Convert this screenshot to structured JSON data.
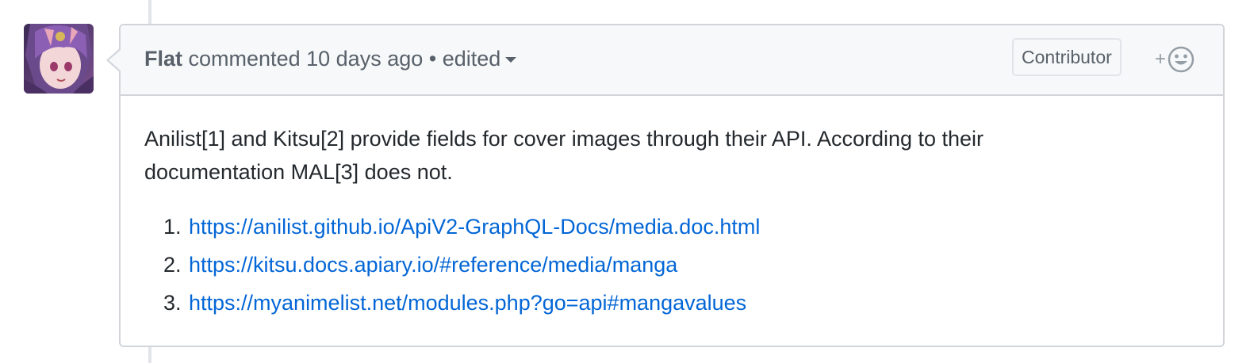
{
  "comment": {
    "author": "Flat",
    "action": "commented",
    "time": "10 days ago",
    "separator": "•",
    "edited_label": "edited",
    "badge": "Contributor",
    "reaction_plus": "+",
    "avatar_icon": "user-avatar",
    "reaction_icon": "smiley-icon",
    "body": {
      "paragraph": "Anilist[1] and Kitsu[2] provide fields for cover images through their API. According to their documentation MAL[3] does not.",
      "references": [
        {
          "number": "1.",
          "url": "https://anilist.github.io/ApiV2-GraphQL-Docs/media.doc.html"
        },
        {
          "number": "2.",
          "url": "https://kitsu.docs.apiary.io/#reference/media/manga"
        },
        {
          "number": "3.",
          "url": "https://myanimelist.net/modules.php?go=api#mangavalues"
        }
      ]
    }
  },
  "colors": {
    "link": "#0366d6",
    "muted": "#586069",
    "border": "#d1d5da",
    "header_bg": "#f6f8fa"
  }
}
